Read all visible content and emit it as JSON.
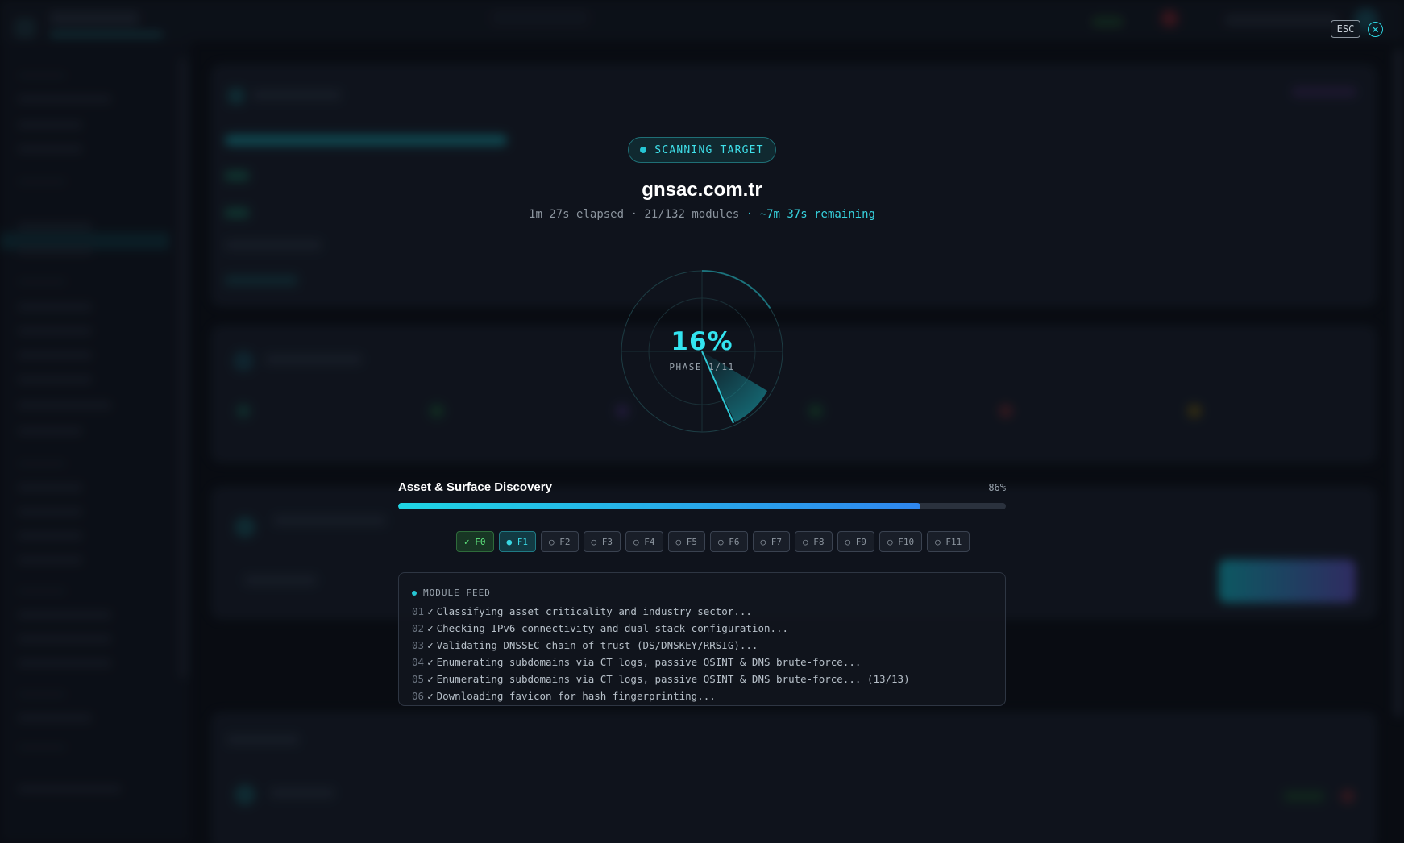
{
  "modal": {
    "esc_label": "ESC",
    "close_glyph": "✕",
    "badge": "SCANNING TARGET",
    "target": "gnsac.com.tr",
    "elapsed": "1m 27s elapsed",
    "modules": "21/132 modules",
    "remaining": "~7m 37s remaining",
    "percent": "16%",
    "percent_value": 16,
    "phase_label": "PHASE 1/11",
    "current_phase": {
      "title": "Asset & Surface Discovery",
      "progress_label": "86%",
      "progress_value": 86
    },
    "phases": [
      {
        "label": "✓ F0",
        "state": "done"
      },
      {
        "label": "● F1",
        "state": "active"
      },
      {
        "label": "○ F2",
        "state": "pending"
      },
      {
        "label": "○ F3",
        "state": "pending"
      },
      {
        "label": "○ F4",
        "state": "pending"
      },
      {
        "label": "○ F5",
        "state": "pending"
      },
      {
        "label": "○ F6",
        "state": "pending"
      },
      {
        "label": "○ F7",
        "state": "pending"
      },
      {
        "label": "○ F8",
        "state": "pending"
      },
      {
        "label": "○ F9",
        "state": "pending"
      },
      {
        "label": "○ F10",
        "state": "pending"
      },
      {
        "label": "○ F11",
        "state": "pending"
      }
    ],
    "feed": {
      "title": "MODULE FEED",
      "lines": [
        {
          "num": "01",
          "text": "Classifying asset criticality and industry sector..."
        },
        {
          "num": "02",
          "text": "Checking IPv6 connectivity and dual-stack configuration..."
        },
        {
          "num": "03",
          "text": "Validating DNSSEC chain-of-trust (DS/DNSKEY/RRSIG)..."
        },
        {
          "num": "04",
          "text": "Enumerating subdomains via CT logs, passive OSINT & DNS brute-force..."
        },
        {
          "num": "05",
          "text": "Enumerating subdomains via CT logs, passive OSINT & DNS brute-force... (13/13)"
        },
        {
          "num": "06",
          "text": "Downloading favicon for hash fingerprinting..."
        }
      ]
    }
  },
  "colors": {
    "accent": "#33e4f0",
    "done": "#5ee37d",
    "progress_start": "#1fd6e4",
    "progress_end": "#2f86ee"
  }
}
